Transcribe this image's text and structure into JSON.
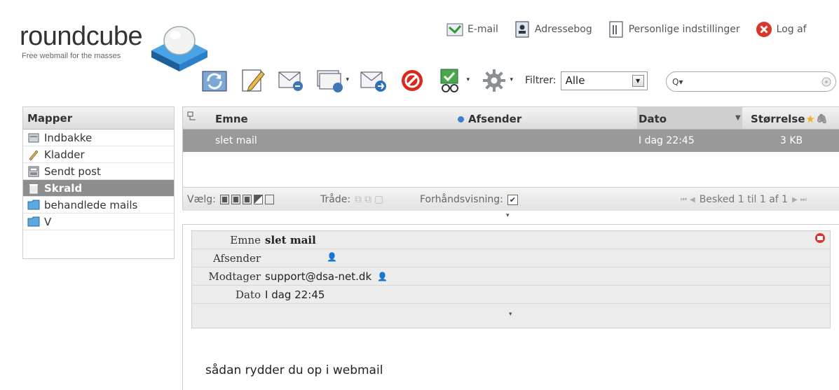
{
  "logo": {
    "word": "roundcube",
    "tagline": "Free webmail for the masses"
  },
  "topnav": {
    "email": "E-mail",
    "addressbook": "Adressebog",
    "settings": "Personlige indstillinger",
    "logout": "Log af"
  },
  "toolbar": {
    "filter_label": "Filtrer:",
    "filter_value": "Alle",
    "search_value": ""
  },
  "folders": {
    "header": "Mapper",
    "items": [
      {
        "label": "Indbakke",
        "icon": "inbox-icon"
      },
      {
        "label": "Kladder",
        "icon": "pencil-icon"
      },
      {
        "label": "Sendt post",
        "icon": "sent-icon"
      },
      {
        "label": "Skrald",
        "icon": "trash-icon",
        "selected": true
      },
      {
        "label": "behandlede mails",
        "icon": "folder-icon"
      },
      {
        "label": "V",
        "icon": "folder-icon"
      }
    ]
  },
  "messagelist": {
    "columns": {
      "subject": "Emne",
      "from": "Afsender",
      "date": "Dato",
      "size": "Størrelse"
    },
    "rows": [
      {
        "subject": "slet mail",
        "from": "",
        "date": "I dag 22:45",
        "size": "3 KB"
      }
    ],
    "footer": {
      "select_label": "Vælg:",
      "threads_label": "Tråde:",
      "preview_label": "Forhåndsvisning:",
      "preview_checked": true,
      "count_text": "Besked 1 til 1 af 1"
    }
  },
  "preview": {
    "subject_label": "Emne",
    "subject": "slet mail",
    "from_label": "Afsender",
    "from": "",
    "to_label": "Modtager",
    "to": "support@dsa-net.dk",
    "date_label": "Dato",
    "date": "I dag 22:45",
    "body": "sådan rydder du op i webmail"
  },
  "colors": {
    "selected_row": "#999999",
    "selected_folder": "#8d8d8d",
    "header_gradient_top": "#f4f4f4",
    "header_gradient_bottom": "#dcdcdc"
  }
}
